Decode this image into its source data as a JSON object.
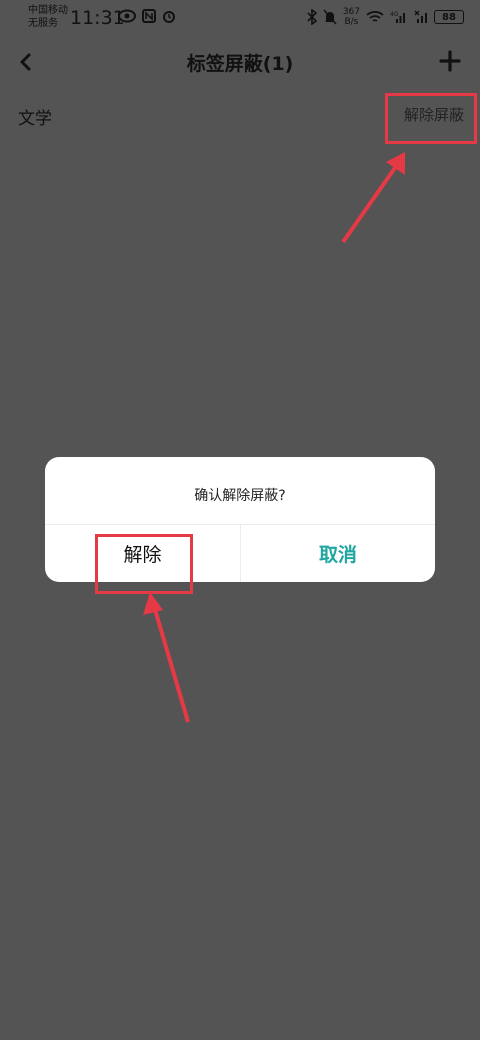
{
  "status_bar": {
    "carrier_line1": "中国移动",
    "carrier_line2": "无服务",
    "time": "11:31",
    "net_speed_value": "367",
    "net_speed_unit": "B/s",
    "signal_label": "4G",
    "battery_level": "88"
  },
  "navbar": {
    "title": "标签屏蔽(1)",
    "back_icon": "chevron-left-icon",
    "add_icon": "plus-icon"
  },
  "tags": [
    {
      "name": "文学",
      "action_label": "解除屏蔽"
    }
  ],
  "dialog": {
    "message": "确认解除屏蔽?",
    "confirm_label": "解除",
    "cancel_label": "取消"
  },
  "colors": {
    "overlay_bg": "#545454",
    "dialog_bg": "#ffffff",
    "cancel_accent": "#1fa6a0",
    "annotation_red": "#e63946"
  }
}
